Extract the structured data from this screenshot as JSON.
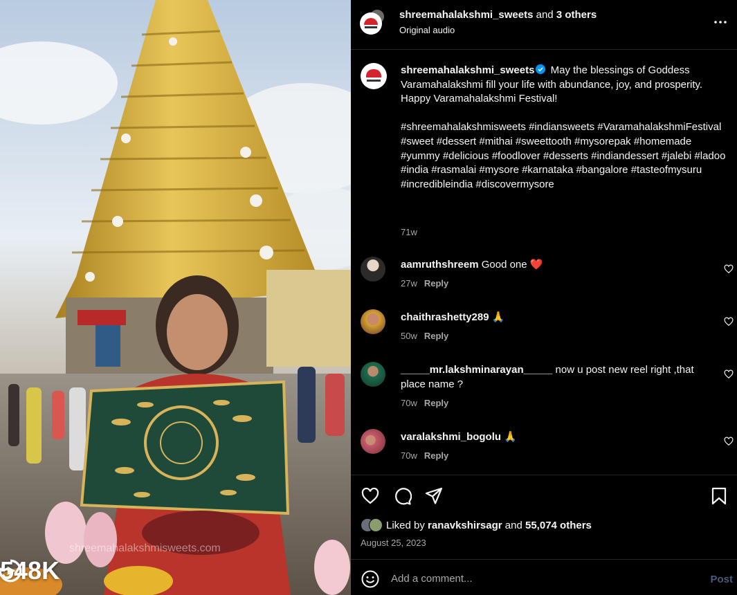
{
  "media": {
    "views": "548K",
    "watermark": "shreemahalakshmisweets.com",
    "icons": {
      "views_icon": "play-circle-icon"
    }
  },
  "header": {
    "username": "shreemahalakshmi_sweets",
    "and_word": "and",
    "others": "3 others",
    "subtitle": "Original audio",
    "icons": {
      "more": "more-horizontal-icon"
    }
  },
  "caption": {
    "username": "shreemahalakshmi_sweets",
    "text_line1": "May the blessings of Goddess Varamahalakshmi fill your life with abundance, joy, and prosperity.",
    "text_line2": "Happy Varamahalakshmi Festival!",
    "hashtags": "#shreemahalakshmisweets #indiansweets #VaramahalakshmiFestival #sweet #dessert #mithai #sweettooth #mysorepak #homemade #yummy #delicious #foodlover #desserts #indiandessert #jalebi #ladoo #india #rasmalai #mysore #karnataka #bangalore #tasteofmysuru #incredibleindia #discovermysore",
    "time": "71w"
  },
  "comments": [
    {
      "username": "aamruthshreem",
      "text": "Good one ❤️",
      "time": "27w",
      "reply": "Reply"
    },
    {
      "username": "chaithrashetty289",
      "text": "🙏",
      "time": "50w",
      "reply": "Reply"
    },
    {
      "username": "_____mr.lakshminarayan_____",
      "text": "now u post new reel right ,that place name ?",
      "time": "70w",
      "reply": "Reply"
    },
    {
      "username": "varalakshmi_bogolu",
      "text": "🙏",
      "time": "70w",
      "reply": "Reply"
    }
  ],
  "actions": {
    "liked_by_prefix": "Liked by",
    "liked_by_user": "ranavkshirsagr",
    "and_word": "and",
    "others": "55,074 others",
    "date": "August 25, 2023",
    "icons": [
      "heart-icon",
      "comment-icon",
      "share-icon",
      "bookmark-icon"
    ]
  },
  "comment_input": {
    "placeholder": "Add a comment...",
    "post_label": "Post"
  },
  "colors": {
    "background": "#000000",
    "divider": "#262626",
    "secondary_text": "#a8a8a8",
    "verified": "#0095f6",
    "post_disabled": "#4a5a7a",
    "temple_gold": "#d9b243"
  }
}
